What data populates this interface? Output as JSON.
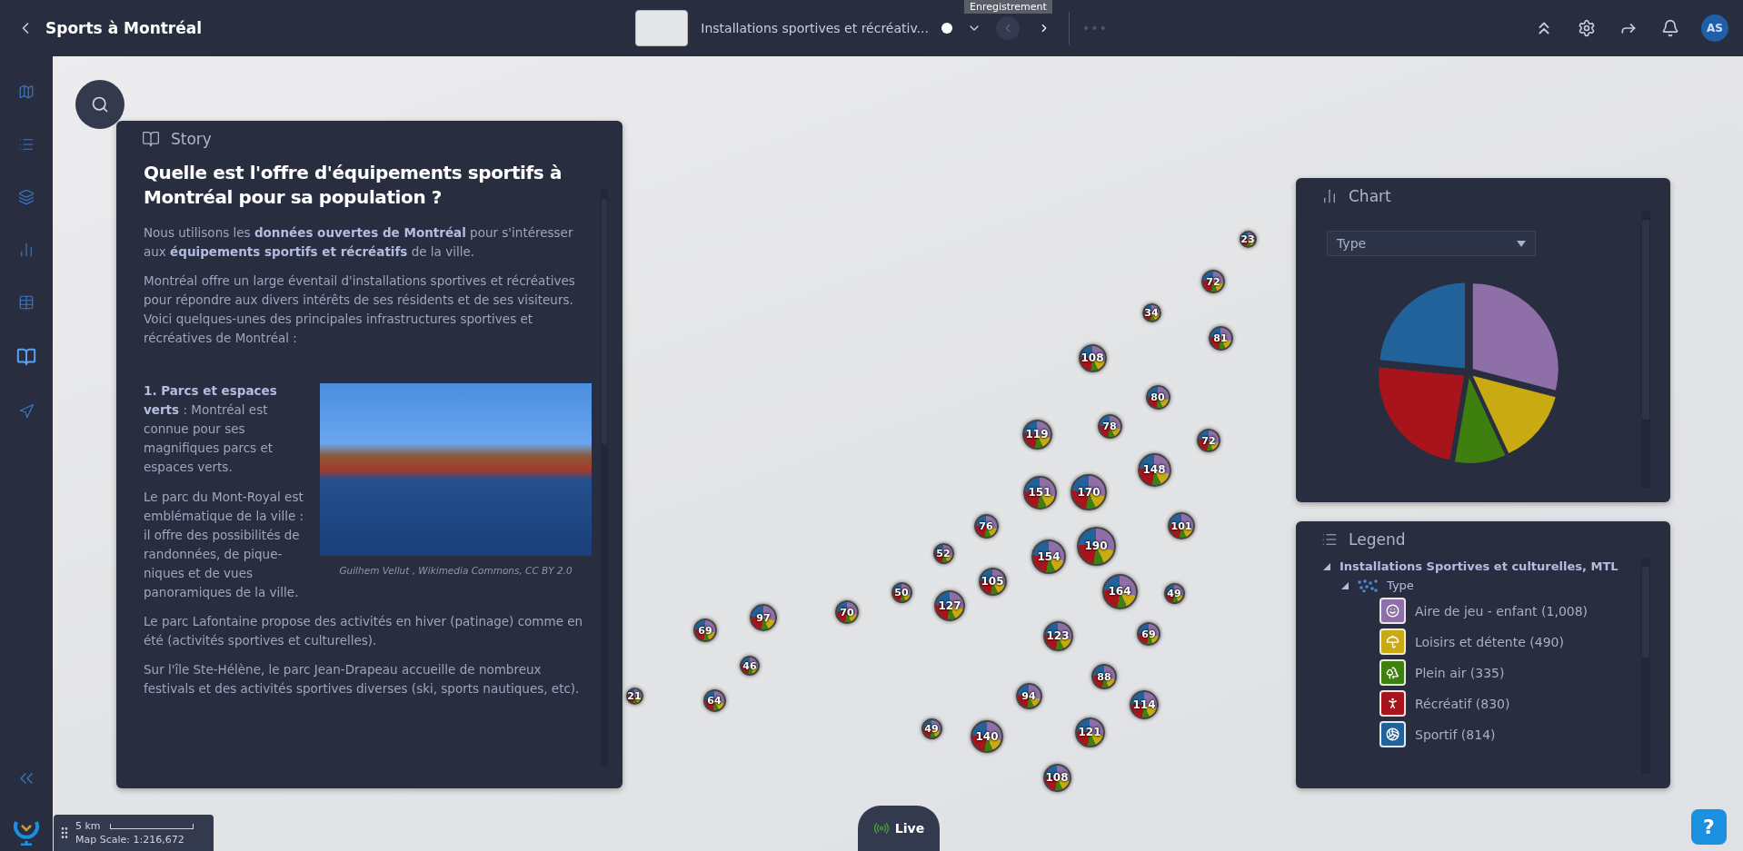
{
  "app_bar": {
    "title": "Sports à Montréal",
    "story_title": "Installations sportives et récréativ...",
    "tooltip": "Enregistrement",
    "more": "•••",
    "avatar": "AS",
    "prev_disabled": true,
    "next_disabled": false
  },
  "sidebar": {
    "items": [
      {
        "selected": false
      },
      {
        "selected": false
      },
      {
        "selected": false
      },
      {
        "selected": false
      },
      {
        "selected": false
      },
      {
        "selected": true
      },
      {
        "selected": false
      }
    ]
  },
  "story": {
    "header": "Story",
    "title": "Quelle est l'offre d'équipements sportifs à Montréal pour sa population ?",
    "intro": [
      "Nous utilisons les **données ouvertes de Montréal** pour s'intéresser aux **équipements sportifs et récréatifs** de la ville.",
      "Montréal offre un large éventail d'installations sportives et récréatives pour répondre aux divers intérêts de ses résidents et de ses visiteurs. Voici quelques-unes des principales infrastructures sportives et récréatives de Montréal :"
    ],
    "section": {
      "paragraphs": [
        "**1. Parcs et espaces verts** : Montréal est connue pour ses magnifiques parcs et espaces verts.",
        "Le parc du Mont-Royal est emblématique de la ville : il offre des possibilités de randonnées, de pique-niques et de vues panoramiques de la ville."
      ],
      "caption": "Guilhem Vellut , Wikimedia Commons, CC BY 2.0"
    },
    "outro": [
      "Le parc Lafontaine propose des activités en hiver (patinage) comme en été (activités sportives et culturelles).",
      "Sur l'île Ste-Hélène, le parc Jean-Drapeau accueille de nombreux festivals et des activités sportives diverses (ski, sports nautiques, etc)."
    ]
  },
  "chart": {
    "header": "Chart",
    "field": "Type",
    "chart_data": {
      "type": "pie",
      "values": [
        28.99,
        14.09,
        9.63,
        23.87,
        23.42
      ]
    }
  },
  "legend": {
    "header": "Legend",
    "layers": [
      {
        "label": "Installations Sportives et culturelles, MTL",
        "expanded": true,
        "children": [
          {
            "label": "Type",
            "expanded": true,
            "children": [
              {
                "label": "Aire de jeu - enfant (1,008)",
                "color": "#8e6fa8"
              },
              {
                "label": "Loisirs et détente (490)",
                "color": "#c9aa12"
              },
              {
                "label": "Plein air (335)",
                "color": "#3f7f10"
              },
              {
                "label": "Récréatif (830)",
                "color": "#a8141b"
              },
              {
                "label": "Sportif (814)",
                "color": "#22629a"
              }
            ]
          }
        ]
      }
    ]
  },
  "map": {
    "clusters": [
      {
        "count": "23"
      },
      {
        "count": "72"
      },
      {
        "count": "34"
      },
      {
        "count": "81"
      },
      {
        "count": "108"
      },
      {
        "count": "80"
      },
      {
        "count": "78"
      },
      {
        "count": "119"
      },
      {
        "count": "72"
      },
      {
        "count": "148"
      },
      {
        "count": "151"
      },
      {
        "count": "170"
      },
      {
        "count": "101"
      },
      {
        "count": "76"
      },
      {
        "count": "190"
      },
      {
        "count": "52"
      },
      {
        "count": "154"
      },
      {
        "count": "105"
      },
      {
        "count": "50"
      },
      {
        "count": "164"
      },
      {
        "count": "49"
      },
      {
        "count": "127"
      },
      {
        "count": "70"
      },
      {
        "count": "97"
      },
      {
        "count": "69"
      },
      {
        "count": "123"
      },
      {
        "count": "69"
      },
      {
        "count": "46"
      },
      {
        "count": "88"
      },
      {
        "count": "21"
      },
      {
        "count": "64"
      },
      {
        "count": "94"
      },
      {
        "count": "114"
      },
      {
        "count": "49"
      },
      {
        "count": "121"
      },
      {
        "count": "140"
      },
      {
        "count": "108"
      }
    ]
  },
  "scale": {
    "distance": "5 km",
    "label": "Map Scale: 1:216,672"
  },
  "live": "Live",
  "help": "?"
}
